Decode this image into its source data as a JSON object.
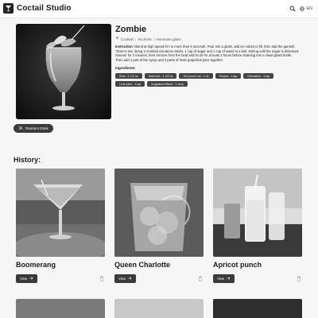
{
  "app": {
    "brand": "Coctail Studio",
    "language": "EN",
    "icons": {
      "logo": "cocktail-glass-icon",
      "search": "search-icon",
      "language": "globe-icon"
    }
  },
  "featured": {
    "title": "Zombie",
    "category": "Cocktail",
    "alcoholic": "Alcoholic",
    "glass": "Hurricane glass",
    "instructions_label": "Instruction:",
    "instructions": "Blend at high speed for no more than 5 seconds. Pour into a glass, add ice cubes to fill, then add the garnish. *Donn's mix: Bring 3 crushed cinnamon sticks, 1 cup of sugar and 1 cup of water to a boil, stirring until the sugar is dissolved. Simmer for 2 minutes, then remove from the heat and let sit for at least 2 hours before straining into a clean glass bottle. Then add 1 part of the syrup and 2 parts of fresh grapefruit juice together.",
    "ingredients_label": "Ingredients:",
    "ingredients": [
      "Rum - 1 1/2 oz",
      "Gold rum - 1 1/2 oz",
      "151 proof rum - 1 oz",
      "Pernod - 1 tsp",
      "Grenadine - 1 tsp",
      "Lime juice - 1 tsp",
      "Angostura bitters - 1 drop"
    ]
  },
  "random_button": {
    "label": "Random Drink",
    "icon": "shuffle-icon"
  },
  "history": {
    "title": "History:",
    "view_label": "View",
    "items": [
      {
        "name": "Boomerang"
      },
      {
        "name": "Queen Charlotte"
      },
      {
        "name": "Apricot punch"
      }
    ]
  }
}
